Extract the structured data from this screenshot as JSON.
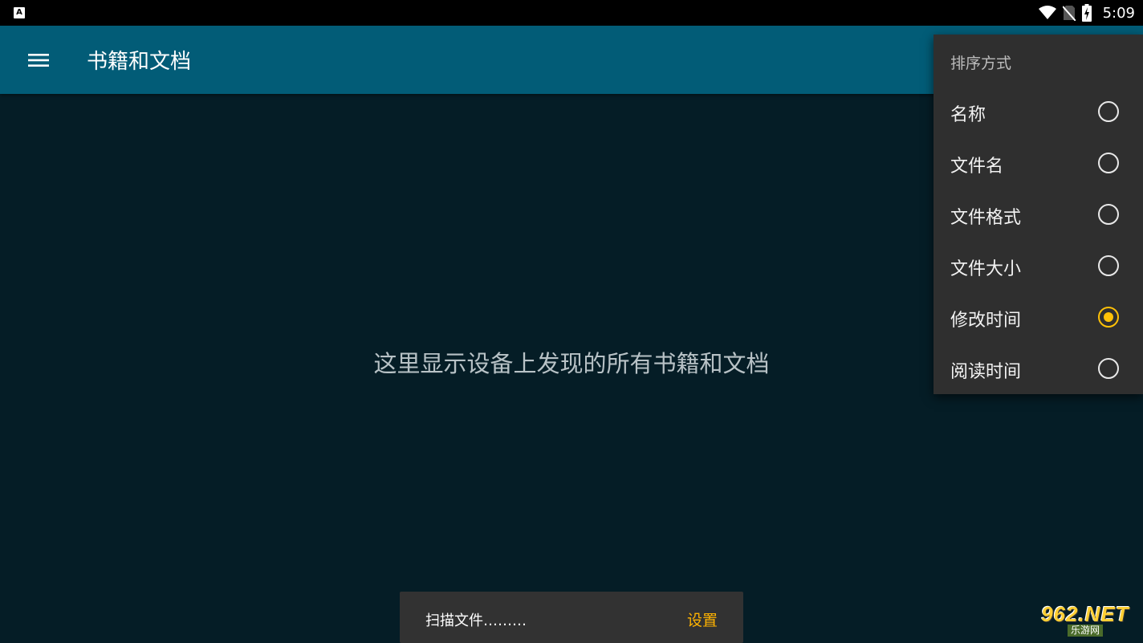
{
  "status_bar": {
    "app_icon_letter": "A",
    "time": "5:09"
  },
  "app_bar": {
    "title": "书籍和文档"
  },
  "main": {
    "empty_message": "这里显示设备上发现的所有书籍和文档"
  },
  "sort_menu": {
    "title": "排序方式",
    "options": [
      {
        "label": "名称",
        "selected": false
      },
      {
        "label": "文件名",
        "selected": false
      },
      {
        "label": "文件格式",
        "selected": false
      },
      {
        "label": "文件大小",
        "selected": false
      },
      {
        "label": "修改时间",
        "selected": true
      },
      {
        "label": "阅读时间",
        "selected": false
      }
    ]
  },
  "snackbar": {
    "message": "扫描文件………",
    "action": "设置"
  },
  "watermark": {
    "main": "962.NET",
    "sub": "乐游网"
  },
  "colors": {
    "app_bar": "#025c77",
    "background": "#051d26",
    "accent": "#ffc107",
    "menu_bg": "#2f2f2f"
  }
}
